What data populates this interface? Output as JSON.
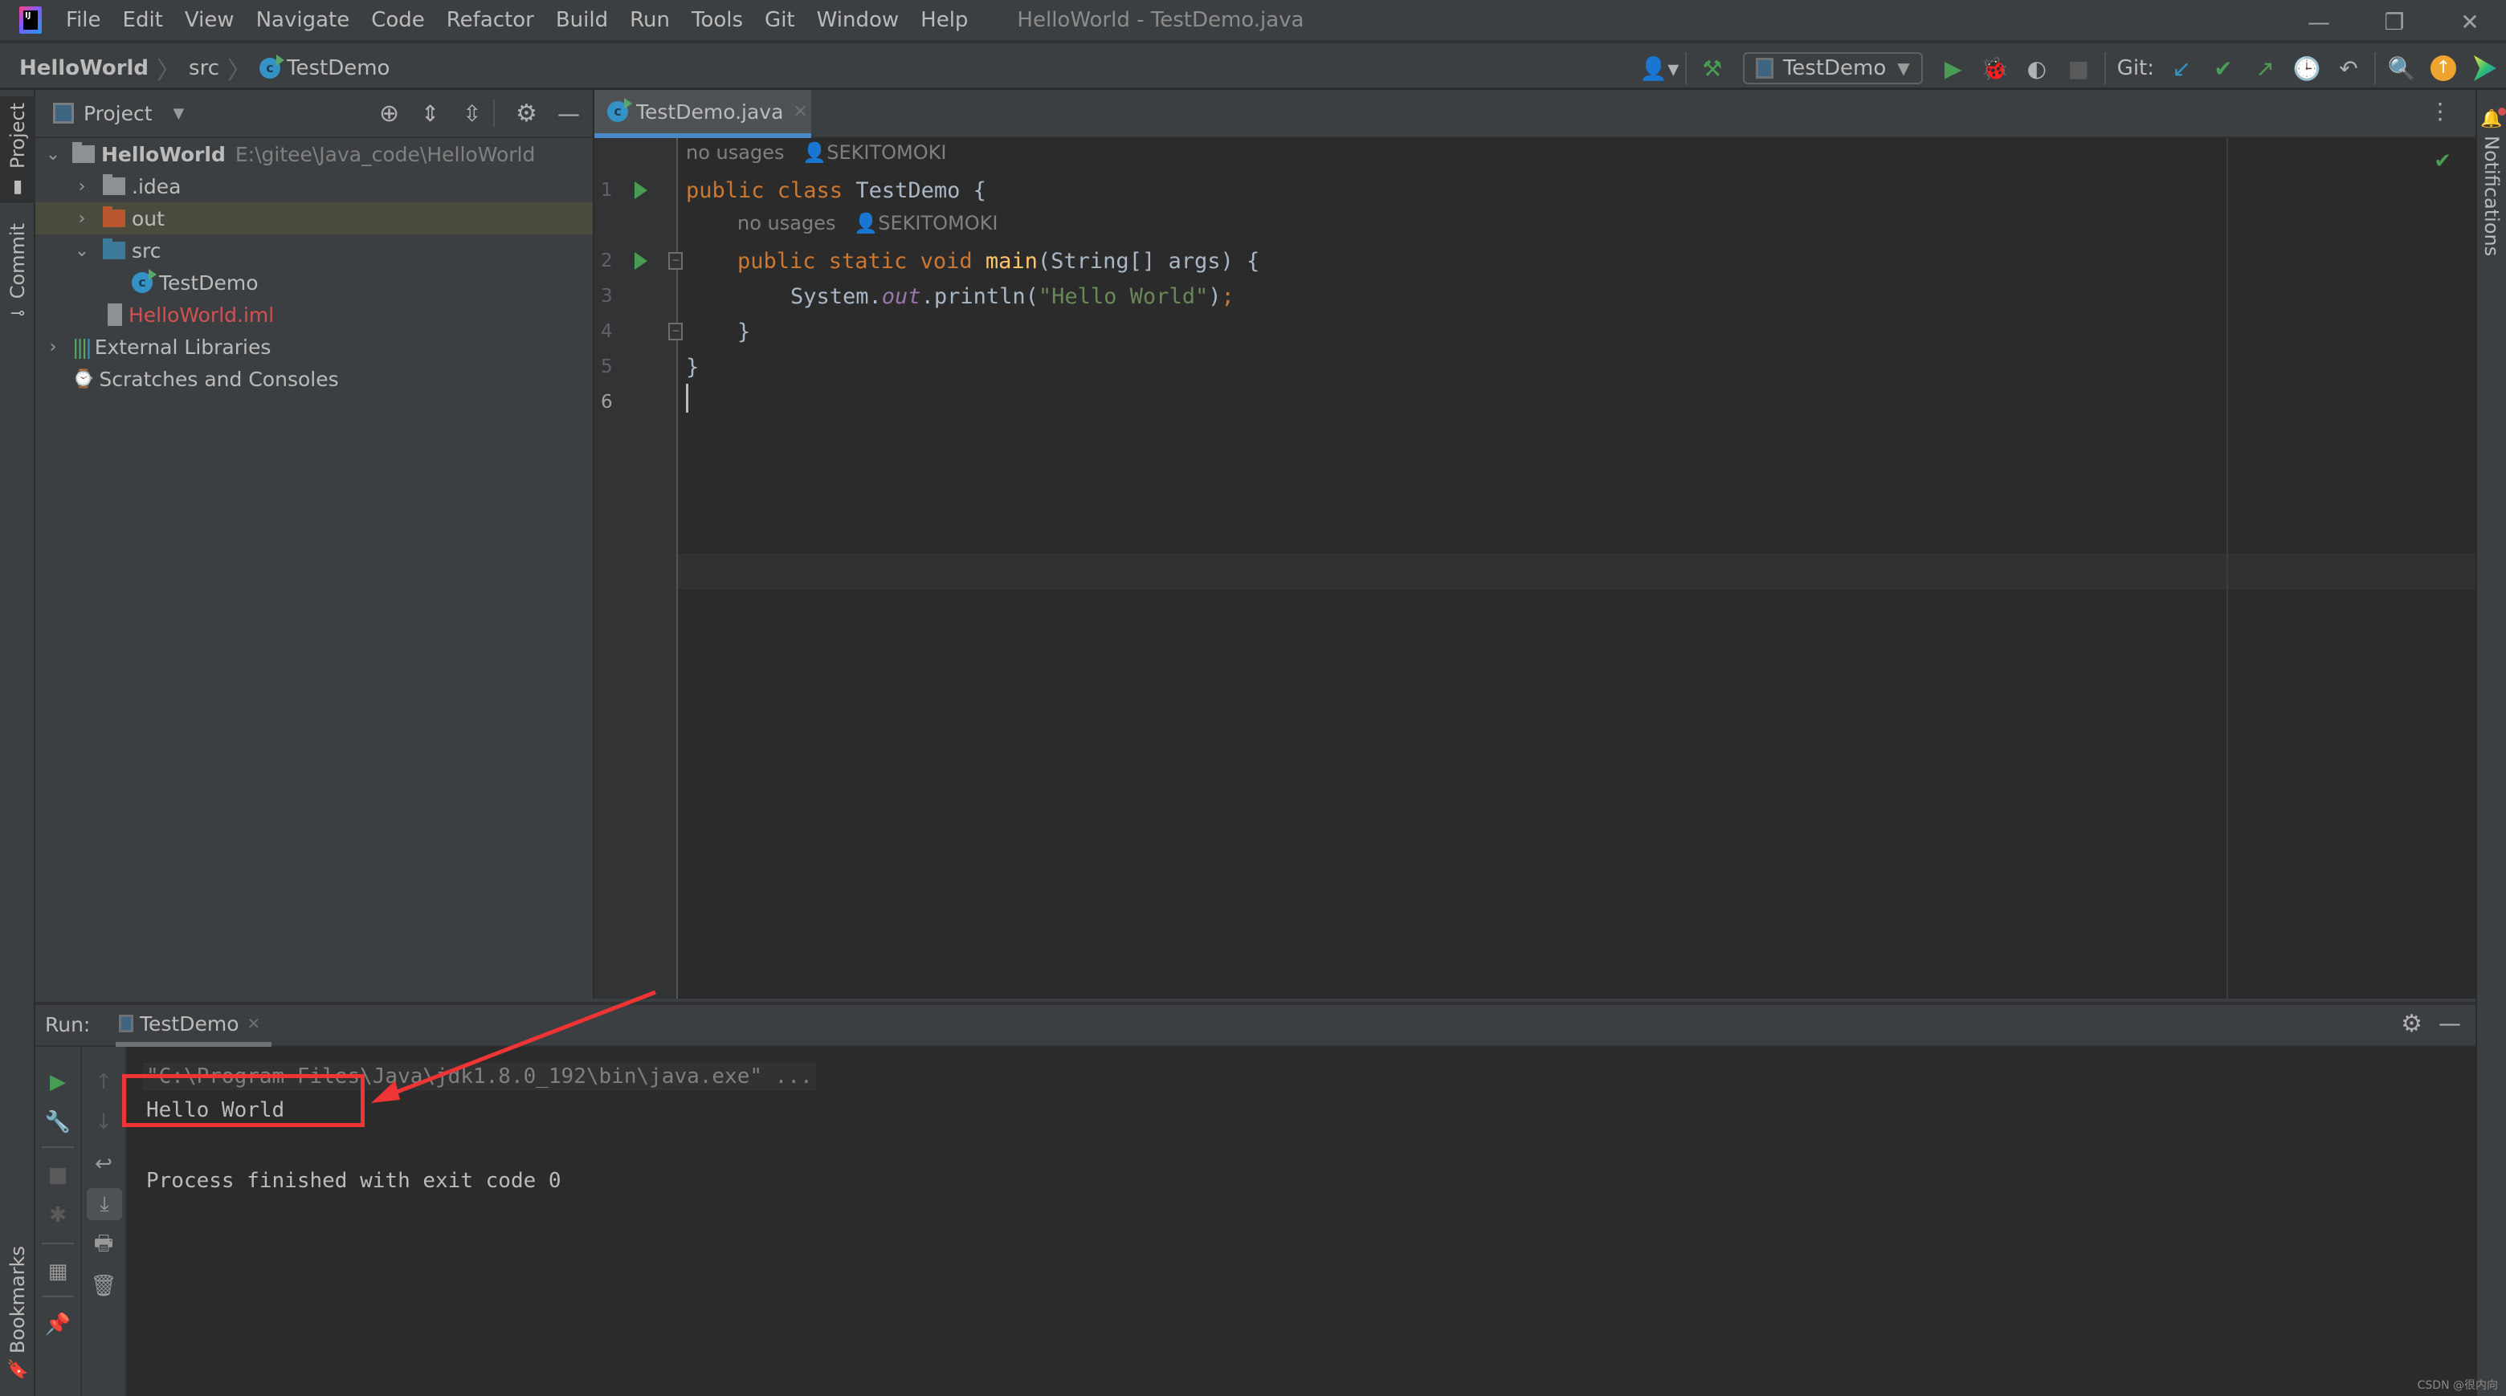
{
  "window": {
    "title": "HelloWorld - TestDemo.java",
    "menu": [
      "File",
      "Edit",
      "View",
      "Navigate",
      "Code",
      "Refactor",
      "Build",
      "Run",
      "Tools",
      "Git",
      "Window",
      "Help"
    ],
    "controls": {
      "minimize": "minimize-icon",
      "restore": "restore-icon",
      "close": "close-icon"
    }
  },
  "navbar": {
    "breadcrumb": [
      "HelloWorld",
      "src",
      "TestDemo"
    ],
    "run_config": "TestDemo",
    "git_label": "Git:",
    "icons": [
      "user-icon",
      "build-hammer-icon",
      "run-icon",
      "debug-icon",
      "coverage-icon",
      "stop-icon",
      "git-update-icon",
      "git-commit-icon",
      "git-push-icon",
      "history-icon",
      "rollback-icon",
      "search-icon",
      "update-available-icon",
      "toolbox-icon"
    ]
  },
  "left_strip": {
    "tabs": [
      "Project",
      "Commit",
      "Bookmarks"
    ]
  },
  "right_strip": {
    "tabs": [
      "Notifications"
    ]
  },
  "project_panel": {
    "title": "Project",
    "tree": [
      {
        "label": "HelloWorld",
        "path": "E:\\gitee\\Java_code\\HelloWorld",
        "indent": 0,
        "expanded": true,
        "type": "project"
      },
      {
        "label": ".idea",
        "indent": 1,
        "expanded": false,
        "type": "folder"
      },
      {
        "label": "out",
        "indent": 1,
        "expanded": false,
        "type": "folder-excluded",
        "selected": true
      },
      {
        "label": "src",
        "indent": 1,
        "expanded": true,
        "type": "folder-source"
      },
      {
        "label": "TestDemo",
        "indent": 2,
        "type": "class"
      },
      {
        "label": "HelloWorld.iml",
        "indent": 1,
        "type": "iml"
      },
      {
        "label": "External Libraries",
        "indent": 0,
        "expanded": false,
        "type": "libraries"
      },
      {
        "label": "Scratches and Consoles",
        "indent": 0,
        "type": "scratches"
      }
    ]
  },
  "editor": {
    "tab": "TestDemo.java",
    "inlays": [
      {
        "usages": "no usages",
        "author": "SEKITOMOKI"
      },
      {
        "usages": "no usages",
        "author": "SEKITOMOKI"
      }
    ],
    "lines": [
      {
        "n": "1"
      },
      {
        "n": "2"
      },
      {
        "n": "3"
      },
      {
        "n": "4"
      },
      {
        "n": "5"
      },
      {
        "n": "6"
      }
    ],
    "code": {
      "l1_kw": "public class ",
      "l1_name": "TestDemo {",
      "l2_kw": "public static void ",
      "l2_fn": "main",
      "l2_rest": "(String[] args) {",
      "l3_a": "System.",
      "l3_fld": "out",
      "l3_b": ".println(",
      "l3_str": "\"Hello World\"",
      "l3_c": ")",
      "l3_semi": ";",
      "l4": "}",
      "l5": "}"
    }
  },
  "run_panel": {
    "label": "Run:",
    "tab": "TestDemo",
    "console": [
      "\"C:\\Program Files\\Java\\jdk1.8.0_192\\bin\\java.exe\" ...",
      "Hello World",
      "",
      "Process finished with exit code 0"
    ]
  },
  "watermark": "CSDN @很内向",
  "colors": {
    "accent": "#4a88c7",
    "run_green": "#499c54",
    "annotation_red": "#ee3434",
    "keyword": "#cc7832",
    "string": "#6a8759"
  }
}
